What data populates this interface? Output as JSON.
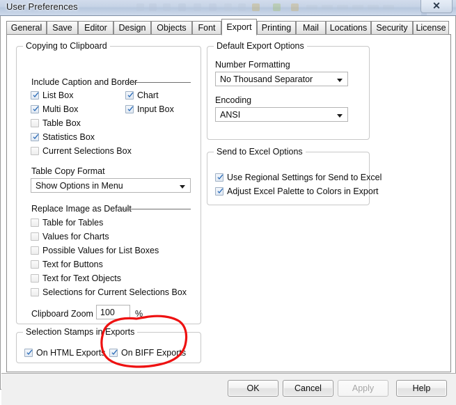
{
  "window": {
    "title": "User Preferences",
    "close_icon": "close-icon",
    "close_glyph": "✕"
  },
  "tabs": [
    {
      "label": "General",
      "active": false
    },
    {
      "label": "Save",
      "active": false
    },
    {
      "label": "Editor",
      "active": false
    },
    {
      "label": "Design",
      "active": false
    },
    {
      "label": "Objects",
      "active": false
    },
    {
      "label": "Font",
      "active": false
    },
    {
      "label": "Export",
      "active": true
    },
    {
      "label": "Printing",
      "active": false
    },
    {
      "label": "Mail",
      "active": false
    },
    {
      "label": "Locations",
      "active": false
    },
    {
      "label": "Security",
      "active": false
    },
    {
      "label": "License",
      "active": false
    }
  ],
  "copying_to_clipboard": {
    "title": "Copying to Clipboard",
    "include_section_label": "Include Caption and Border",
    "checkboxes_left": [
      {
        "label": "List Box",
        "checked": true
      },
      {
        "label": "Multi Box",
        "checked": true
      },
      {
        "label": "Table Box",
        "checked": false
      },
      {
        "label": "Statistics Box",
        "checked": true
      },
      {
        "label": "Current Selections Box",
        "checked": false
      }
    ],
    "checkboxes_right": [
      {
        "label": "Chart",
        "checked": true
      },
      {
        "label": "Input Box",
        "checked": true
      }
    ],
    "table_copy_format": {
      "label": "Table Copy Format",
      "value": "Show Options in Menu"
    },
    "replace_image_label": "Replace Image as Default",
    "replace_image_checkboxes": [
      {
        "label": "Table for Tables",
        "checked": false
      },
      {
        "label": "Values for Charts",
        "checked": false
      },
      {
        "label": "Possible Values for List Boxes",
        "checked": false
      },
      {
        "label": "Text for Buttons",
        "checked": false
      },
      {
        "label": "Text for Text Objects",
        "checked": false
      },
      {
        "label": "Selections for Current Selections Box",
        "checked": false
      }
    ],
    "clipboard_zoom": {
      "label": "Clipboard Zoom",
      "value": "100",
      "unit": "%"
    }
  },
  "default_export_options": {
    "title": "Default Export Options",
    "number_formatting": {
      "label": "Number Formatting",
      "value": "No Thousand Separator"
    },
    "encoding": {
      "label": "Encoding",
      "value": "ANSI"
    }
  },
  "send_to_excel_options": {
    "title": "Send to Excel Options",
    "checkboxes": [
      {
        "label": "Use Regional Settings for Send to Excel",
        "checked": true
      },
      {
        "label": "Adjust Excel Palette to Colors in Export",
        "checked": true
      }
    ]
  },
  "selection_stamps": {
    "title": "Selection Stamps in Exports",
    "checkboxes": [
      {
        "label": "On HTML Exports",
        "checked": true
      },
      {
        "label": "On BIFF Exports",
        "checked": true
      }
    ]
  },
  "footer_buttons": [
    {
      "label": "OK",
      "enabled": true
    },
    {
      "label": "Cancel",
      "enabled": true
    },
    {
      "label": "Apply",
      "enabled": false
    },
    {
      "label": "Help",
      "enabled": true
    }
  ],
  "annotation": {
    "shape": "hand-drawn-red-ellipse",
    "color": "#ee1111",
    "target": "On BIFF Exports"
  },
  "colors": {
    "dialog_background": "#ffffff",
    "footer_background": "#f0f0f0",
    "group_border": "#c8c8c8",
    "checkbox_check": "#2b6cb8",
    "annotation_red": "#ee1111"
  }
}
